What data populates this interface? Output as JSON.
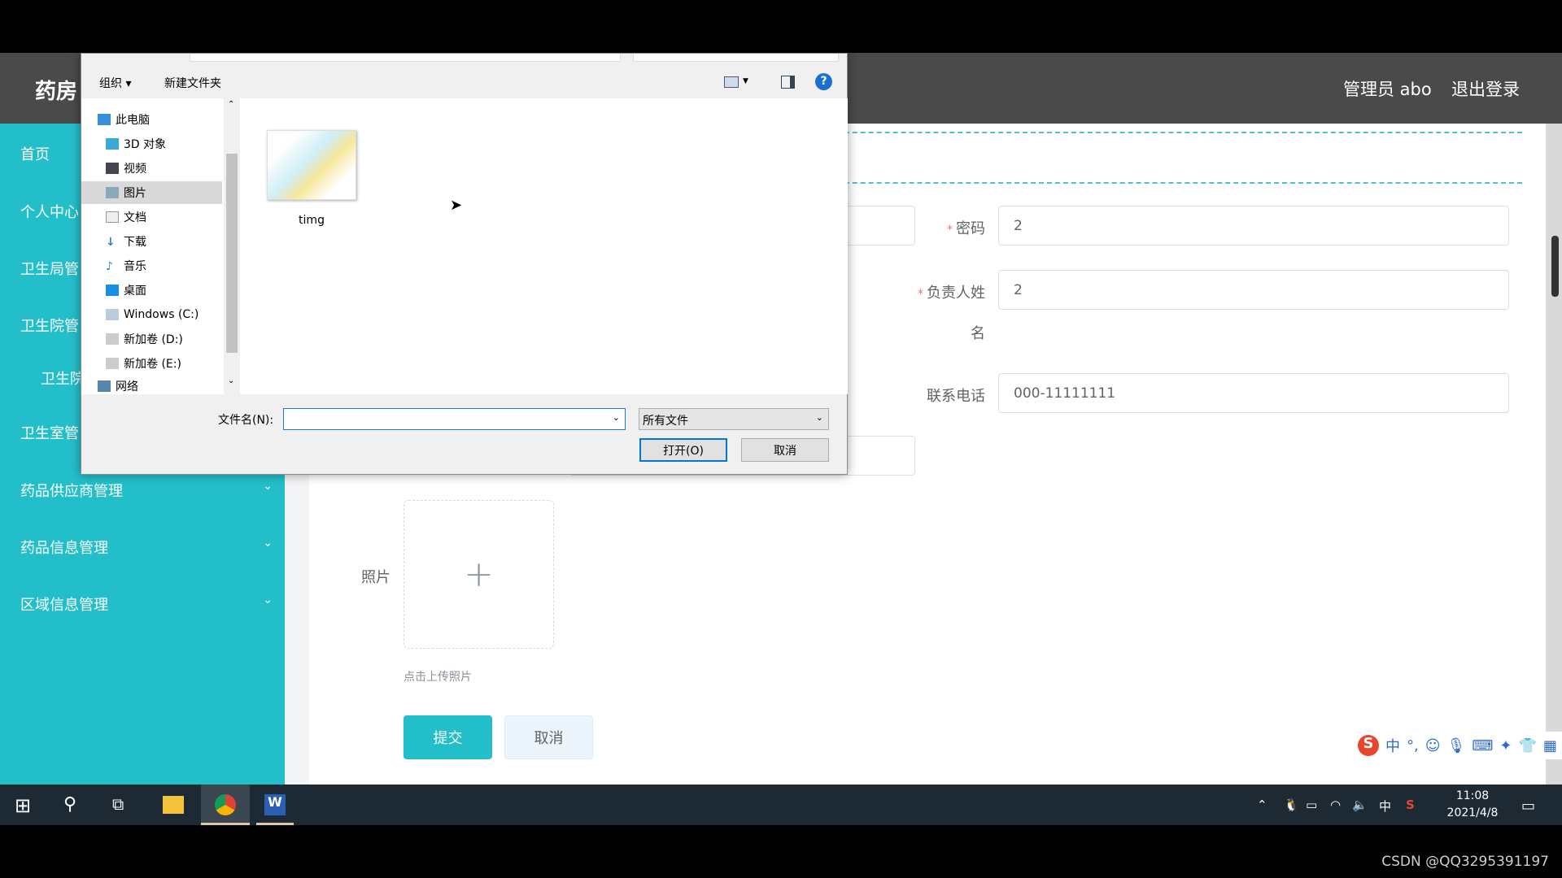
{
  "app": {
    "title": "药房",
    "user_label": "管理员 abo",
    "logout": "退出登录"
  },
  "sidebar": {
    "items": [
      {
        "label": "首页"
      },
      {
        "label": "个人中心"
      },
      {
        "label": "卫生局管"
      },
      {
        "label": "卫生院管"
      },
      {
        "label": "卫生院"
      },
      {
        "label": "卫生室管"
      },
      {
        "label": "药品供应商管理",
        "chevron": "chevron-down"
      },
      {
        "label": "药品信息管理",
        "chevron": "chevron-down"
      },
      {
        "label": "区域信息管理",
        "chevron": "chevron-down"
      }
    ]
  },
  "form": {
    "password": {
      "label": "密码",
      "value": "2",
      "required": true
    },
    "owner_name": {
      "label": "负责人姓",
      "label_wrap": "名",
      "value": "2",
      "required": true
    },
    "phone": {
      "label": "联系电话",
      "value": "000-11111111"
    },
    "photo": {
      "label": "照片",
      "hint": "点击上传照片",
      "icon": "plus-icon"
    },
    "submit": "提交",
    "cancel": "取消"
  },
  "dialog": {
    "toolbar": {
      "organize": "组织 ▾",
      "new_folder": "新建文件夹"
    },
    "nav": [
      "此电脑",
      "3D 对象",
      "视频",
      "图片",
      "文档",
      "下载",
      "音乐",
      "桌面",
      "Windows (C:)",
      "新加卷 (D:)",
      "新加卷 (E:)",
      "网络"
    ],
    "nav_selected": "图片",
    "files": [
      {
        "name": "timg"
      }
    ],
    "filename_label": "文件名(N):",
    "filename_value": "",
    "filter": "所有文件",
    "open": "打开(O)",
    "cancel": "取消"
  },
  "taskbar": {
    "time": "11:08",
    "date": "2021/4/8",
    "ime": "中"
  },
  "ime_bar": {
    "lang": "中",
    "punct": "°,"
  },
  "watermark": "CSDN @QQ3295391197",
  "colors": {
    "sidebar": "#22bfca",
    "header": "#4a4a4a",
    "accent": "#22bfca",
    "required": "#f56c6c"
  }
}
